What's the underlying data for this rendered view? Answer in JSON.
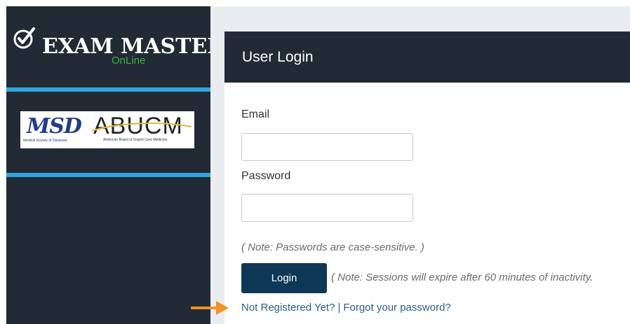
{
  "sidebar": {
    "logo": {
      "brand": "EXAM MASTER",
      "reg_mark": "®",
      "sub": "OnLine"
    },
    "partners": {
      "msd": "MSD",
      "msd_sub": "Medical Society of Delaware",
      "abucm": "ABUCM",
      "abucm_sub": "American Board of Urgent Care Medicine"
    }
  },
  "login": {
    "title": "User Login",
    "email_label": "Email",
    "email_value": "",
    "password_label": "Password",
    "password_value": "",
    "password_note": "( Note: Passwords are case-sensitive. )",
    "login_button": "Login",
    "session_note": "( Note: Sessions will expire after 60 minutes of inactivity.",
    "register_link": "Not Registered Yet?",
    "link_separator": "|",
    "forgot_link": "Forgot your password?"
  },
  "colors": {
    "sidebar_bg": "#212a35",
    "accent_line": "#2ea6df",
    "online_green": "#3cb23a",
    "button_bg": "#0f3856",
    "link": "#2a5e8c",
    "arrow": "#f39325"
  },
  "icons": {
    "check": "check-circle-icon",
    "arrow": "arrow-right-icon"
  }
}
